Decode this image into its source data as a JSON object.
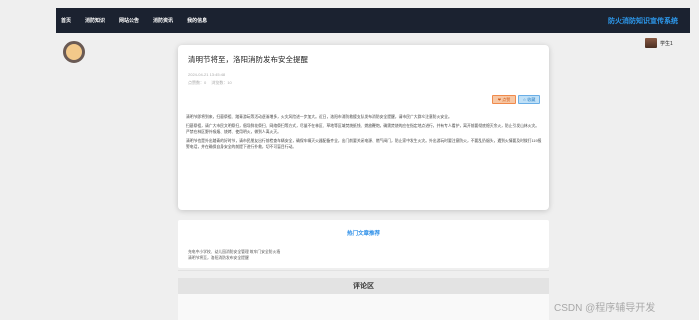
{
  "nav": {
    "items": [
      "首页",
      "消防知识",
      "网站公告",
      "消防资讯",
      "我的信息"
    ],
    "brand": "防火消防知识宣传系统"
  },
  "user": {
    "name": "学生1"
  },
  "article": {
    "title": "清明节将至，洛阳消防发布安全提醒",
    "date": "2024-04-21 13:45:48",
    "meta": "点赞数：0 　浏览数：10",
    "like_label": "❤ 点赞",
    "fav_label": "☆ 收藏",
    "paragraphs": [
      "清明节即将到来，扫墓祭祖、踏青游玩等活动逐渐增多，火灾风险进一步加大。近日，洛阳市消防救援支队发布消防安全提醒，请市民广大群众注意防火安全。",
      "扫墓祭祖，请广大市民文明祭扫，倡导鲜花祭扫、网络祭扫等方式，尽量不在林区、草地等区域焚烧纸钱、燃放鞭炮，确需焚烧的应在指定地点进行，并有专人看护，离开前要彻底熄灭余火，防止引发山林火灾。严禁在林区野外吸烟、烧烤、使用明火，做到人离火灭。",
      "清明节也是外出踏青的好时节，请市民朋友出行前检查车辆安全，确保车辆灭火器配备齐全，出门前要关闭电源、燃气阀门，防止家中发生火灾。外出游玩时要注意防火，不要乱扔烟头，遇到火情要及时拨打119报警电话，并在确保自身安全的前提下进行扑救，切不可盲目行动。"
    ]
  },
  "related": {
    "title": "热门文章推荐",
    "items": [
      "充电中小学校、幼儿园消防安全管理 筑牢门安全防火墙",
      "清明节将至，洛阳消防发布安全提醒"
    ]
  },
  "comments": {
    "title": "评论区"
  },
  "watermark": "CSDN @程序辅导开发"
}
